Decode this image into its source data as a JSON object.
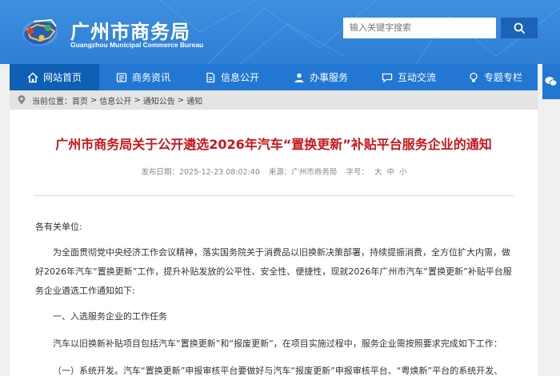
{
  "header": {
    "logo_cn": "广州市商务局",
    "logo_en": "Guangzhou Municipal Commerce Bureau",
    "search_placeholder": "输入关键字搜索"
  },
  "nav": {
    "items": [
      {
        "label": "网站首页",
        "icon": "home-icon"
      },
      {
        "label": "商务资讯",
        "icon": "list-icon"
      },
      {
        "label": "信息公开",
        "icon": "document-icon"
      },
      {
        "label": "办事服务",
        "icon": "user-icon"
      },
      {
        "label": "互动交流",
        "icon": "chat-icon"
      },
      {
        "label": "专题专栏",
        "icon": "bulb-icon"
      }
    ]
  },
  "breadcrumb": {
    "prefix": "当前位置：",
    "items": [
      "首页",
      "信息公开",
      "通知公告",
      "通知"
    ],
    "separator": ">"
  },
  "article": {
    "title": "广州市商务局关于公开遴选2026年汽车“置换更新”补贴平台服务企业的通知",
    "date": "发布日期：2025-12-23 08:02:40",
    "source": "来源：广州市商务局",
    "font_size_label": "字号：",
    "font_sizes": [
      "大",
      "中",
      "小"
    ],
    "addressee": "各有关单位:",
    "paragraph1": "为全面贯彻党中央经济工作会议精神，落实国务院关于消费品以旧换新决策部署，持续提振消费，全方位扩大内需，做好2026年汽车“置换更新”工作，提升补贴发放的公平性、安全性、便捷性，现就2026年广州市汽车“置换更新”补贴平台服务企业遴选工作通知如下:",
    "section1": "一、入选服务企业的工作任务",
    "paragraph2": "汽车以旧换新补贴项目包括汽车“置换更新”和“报废更新”，在项目实施过程中，服务企业需按照要求完成如下工作：",
    "paragraph3": "（一）系统开发。汽车“置换更新”申报审核平台要做好与汽车“报废更新”申报审核平台、“粤焕新”平台的系统开发、"
  },
  "colors": {
    "header_blue": "#3d8fe0",
    "nav_blue": "#2277d2",
    "nav_active": "#0f5fb4",
    "title_red": "#c8161d"
  }
}
